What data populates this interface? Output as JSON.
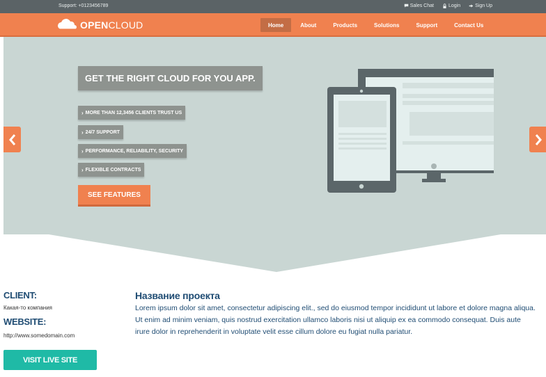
{
  "topbar": {
    "support": "Support: +0123456789",
    "links": [
      {
        "label": "Sales Chat",
        "icon": "chat-icon"
      },
      {
        "label": "Login",
        "icon": "lock-icon"
      },
      {
        "label": "Sign Up",
        "icon": "signin-icon"
      }
    ]
  },
  "brand": {
    "bold": "OPEN",
    "regular": "CLOUD"
  },
  "nav": {
    "items": [
      "Home",
      "About",
      "Products",
      "Solutions",
      "Support",
      "Contact Us"
    ],
    "active": "Home"
  },
  "hero": {
    "headline": "GET THE RIGHT CLOUD FOR YOU APP.",
    "features": [
      "MORE THAN 12,3456 CLIENTS TRUST US",
      "24/7 SUPPORT",
      "PERFORMANCE, RELIABILITY, SECURITY",
      "FLEXIBLE CONTRACTS"
    ],
    "cta": "SEE FEATURES",
    "chevron": "›"
  },
  "colors": {
    "accent": "#f0814f",
    "topbar": "#5b6366",
    "hero_bg": "#c9d6d3",
    "label_bg": "#8e938f",
    "teal": "#1fbaa6",
    "text_dark": "#1f4c73"
  },
  "project": {
    "client_label": "CLIENT:",
    "client_value": "Какая-то компания",
    "website_label": "WEBSITE:",
    "website_value": "http://www.somedomain.com",
    "visit_button": "VISIT LIVE SITE",
    "title": "Название проекта",
    "description": "Lorem ipsum dolor sit amet, consectetur adipiscing elit., sed do eiusmod tempor incididunt ut labore et dolore magna aliqua. Ut enim ad minim veniam, quis nostrud exercitation ullamco laboris nisi ut aliquip ex ea commodo consequat. Duis aute irure dolor in reprehenderit in voluptate velit esse cillum dolore eu fugiat nulla pariatur."
  }
}
